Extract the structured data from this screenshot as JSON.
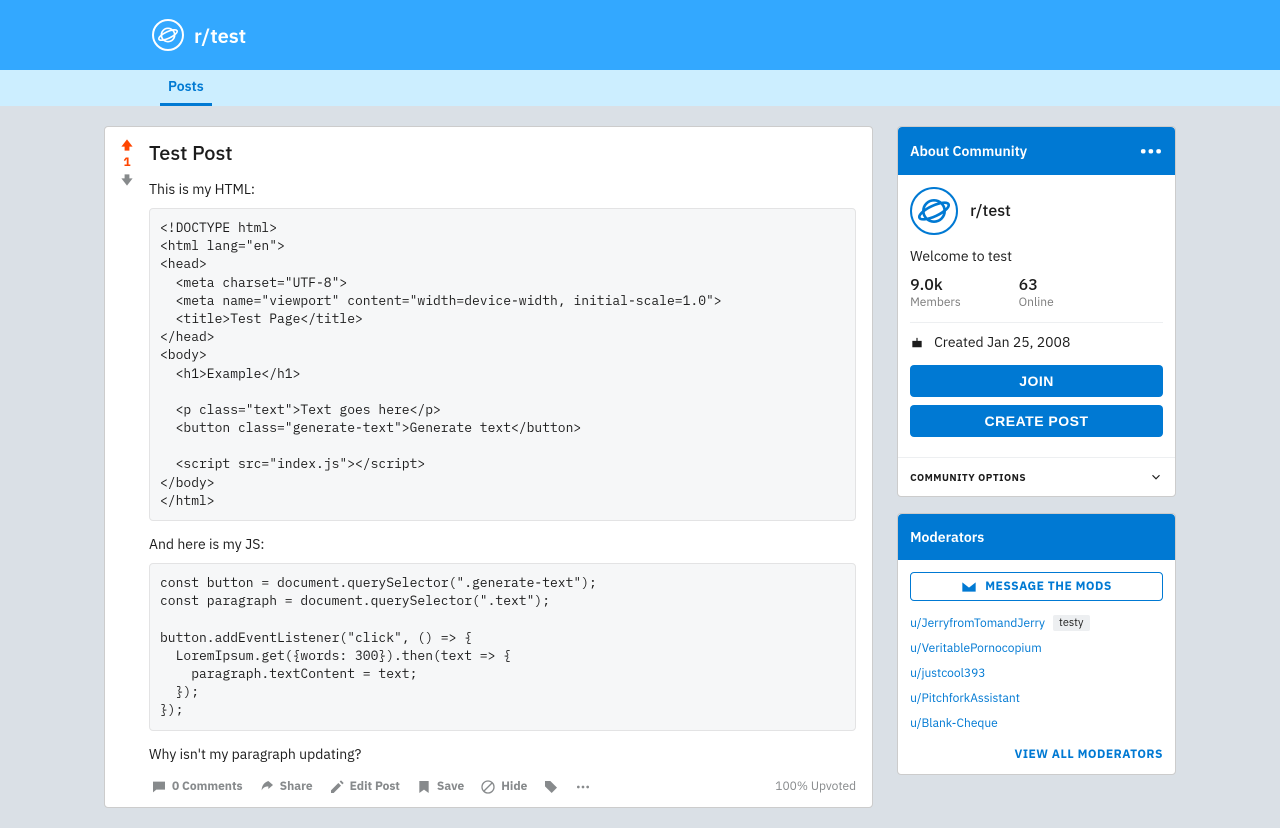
{
  "banner": {
    "title": "r/test"
  },
  "tabs": {
    "posts": "Posts"
  },
  "post": {
    "score": "1",
    "title": "Test Post",
    "intro": "This is my HTML:",
    "code1": "<!DOCTYPE html>\n<html lang=\"en\">\n<head>\n  <meta charset=\"UTF-8\">\n  <meta name=\"viewport\" content=\"width=device-width, initial-scale=1.0\">\n  <title>Test Page</title>\n</head>\n<body>\n  <h1>Example</h1>\n\n  <p class=\"text\">Text goes here</p>\n  <button class=\"generate-text\">Generate text</button>\n\n  <script src=\"index.js\"></script>\n</body>\n</html>",
    "mid": "And here is my JS:",
    "code2": "const button = document.querySelector(\".generate-text\");\nconst paragraph = document.querySelector(\".text\");\n\nbutton.addEventListener(\"click\", () => {\n  LoremIpsum.get({words: 300}).then(text => {\n    paragraph.textContent = text;\n  });\n});",
    "outro": "Why isn't my paragraph updating?",
    "actions": {
      "comments": "0 Comments",
      "share": "Share",
      "edit": "Edit Post",
      "save": "Save",
      "hide": "Hide"
    },
    "upvoted": "100% Upvoted"
  },
  "about": {
    "header": "About Community",
    "name": "r/test",
    "desc": "Welcome to test",
    "members_num": "9.0k",
    "members_lbl": "Members",
    "online_num": "63",
    "online_lbl": "Online",
    "created": "Created Jan 25, 2008",
    "join": "JOIN",
    "create": "CREATE POST",
    "options": "COMMUNITY OPTIONS"
  },
  "mods": {
    "header": "Moderators",
    "msg": "MESSAGE THE MODS",
    "list": [
      {
        "name": "u/JerryfromTomandJerry",
        "tag": "testy"
      },
      {
        "name": "u/VeritablePornocopium",
        "tag": ""
      },
      {
        "name": "u/justcool393",
        "tag": ""
      },
      {
        "name": "u/PitchforkAssistant",
        "tag": ""
      },
      {
        "name": "u/Blank-Cheque",
        "tag": ""
      }
    ],
    "viewall": "VIEW ALL MODERATORS"
  }
}
